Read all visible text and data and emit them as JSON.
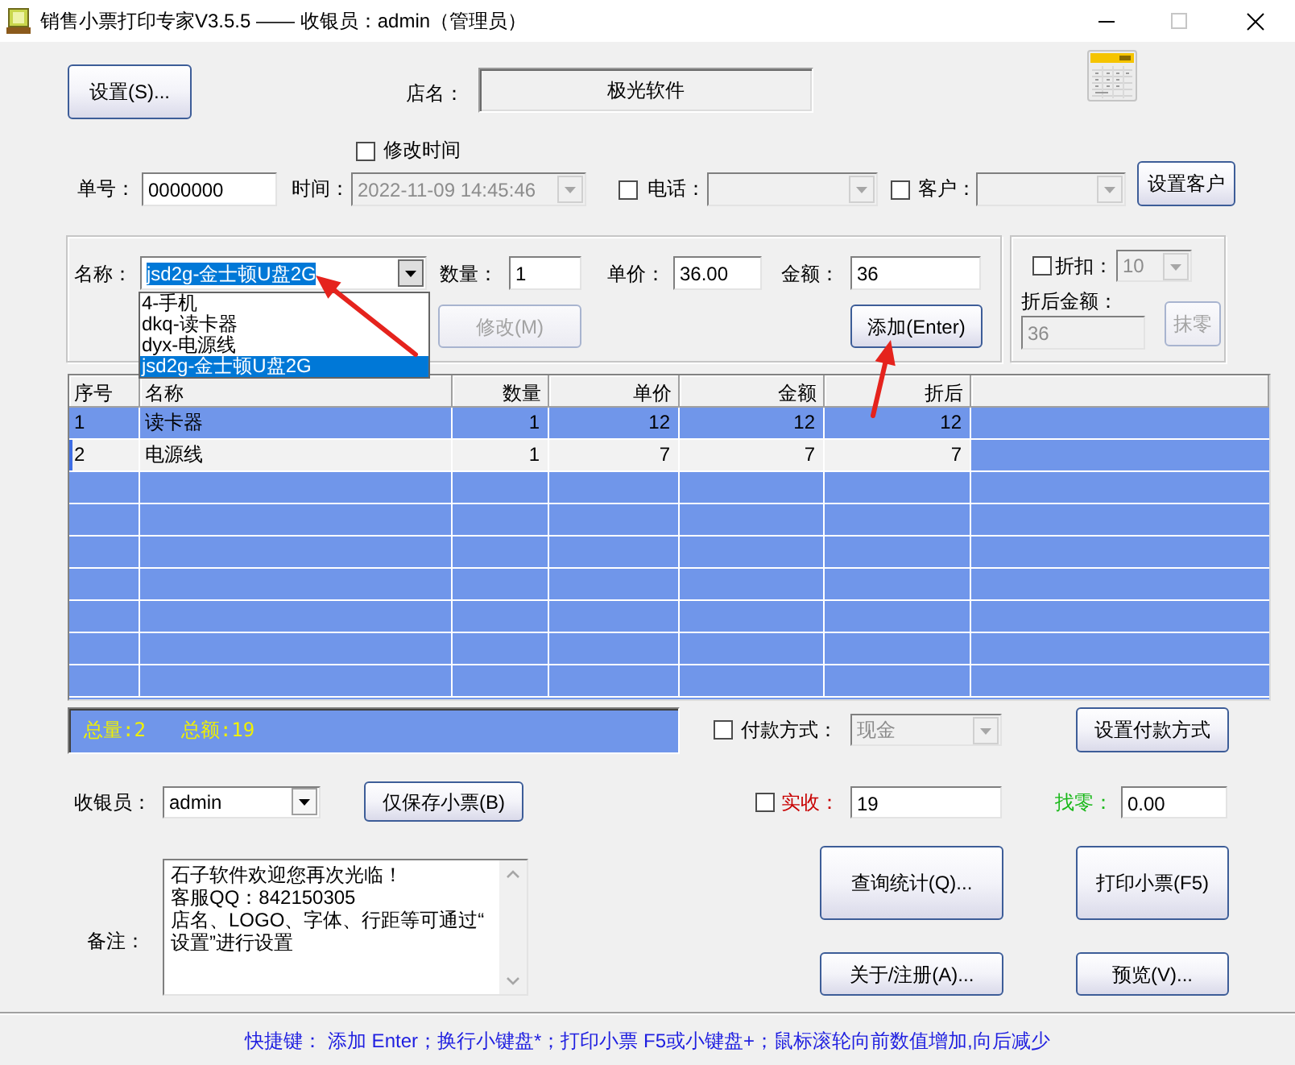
{
  "window": {
    "title": "销售小票打印专家V3.5.5 —— 收银员：admin（管理员）",
    "maximize_disabled": true
  },
  "header": {
    "settings_button": "设置(S)...",
    "store_label": "店名：",
    "store_name": "极光软件",
    "edit_time": {
      "label": "修改时间",
      "checked": false
    }
  },
  "order": {
    "number": {
      "label": "单号：",
      "value": "0000000"
    },
    "time": {
      "label": "时间：",
      "value": "2022-11-09 14:45:46",
      "disabled": true
    },
    "phone": {
      "label": "电话：",
      "checked": false,
      "disabled": true
    },
    "customer": {
      "label": "客户：",
      "checked": false,
      "disabled": true
    },
    "customer_button": "设置客户"
  },
  "item_entry": {
    "name": {
      "label": "名称：",
      "value": "jsd2g-金士顿U盘2G",
      "disabled": false,
      "focused": true,
      "expanded": true,
      "options": [
        {
          "text": "4-手机",
          "selected": false
        },
        {
          "text": "dkq-读卡器",
          "selected": false
        },
        {
          "text": "dyx-电源线",
          "selected": false
        },
        {
          "text": "jsd2g-金士顿U盘2G",
          "selected": true
        }
      ]
    },
    "quantity": {
      "label": "数量：",
      "value": "1"
    },
    "unit_price": {
      "label": "单价：",
      "value": "36.00"
    },
    "amount": {
      "label": "金额：",
      "value": "36"
    },
    "buttons": [
      {
        "label": "修改(M)",
        "disabled": true
      },
      {
        "label": "添加(Enter)",
        "disabled": false
      }
    ]
  },
  "discount": {
    "label": "折扣：",
    "checked": false,
    "rate": {
      "value": "10",
      "disabled": true
    },
    "after_label": "折后金额：",
    "after_amount": {
      "value": "36",
      "disabled": true
    },
    "round_button": {
      "label": "抹零",
      "disabled": true
    }
  },
  "table": {
    "columns": [
      "序号",
      "名称",
      "数量",
      "单价",
      "金额",
      "折后"
    ],
    "rows": [
      {
        "cells": [
          "1",
          "读卡器",
          "1",
          "12",
          "12",
          "12"
        ],
        "selected": false
      },
      {
        "cells": [
          "2",
          "电源线",
          "1",
          "7",
          "7",
          "7"
        ],
        "selected": true
      }
    ]
  },
  "summary": {
    "total_quantity": "总量:2",
    "total_amount": "总额:19"
  },
  "payment": {
    "label": "付款方式：",
    "checked": false,
    "method": {
      "value": "现金",
      "disabled": true
    },
    "button": "设置付款方式"
  },
  "cashier": {
    "label": "收银员：",
    "value": "admin",
    "disabled": false,
    "save_button": "仅保存小票(B)"
  },
  "received": {
    "label": "实收：",
    "checked": false,
    "value": "19"
  },
  "change": {
    "label": "找零：",
    "value": "0.00"
  },
  "note": {
    "label": "备注：",
    "lines": [
      "石子软件欢迎您再次光临！",
      "客服QQ：842150305",
      "店名、LOGO、字体、行距等可通过“",
      "设置”进行设置"
    ]
  },
  "actions": [
    "查询统计(Q)...",
    "打印小票(F5)",
    "关于/注册(A)...",
    "预览(V)..."
  ],
  "status_bar": {
    "text": "快捷键： 添加 Enter；换行小键盘*；打印小票 F5或小键盘+；鼠标滚轮向前数值增加,向后减少"
  },
  "annotations": [
    {
      "kind": "arrow"
    },
    {
      "kind": "arrow"
    }
  ]
}
